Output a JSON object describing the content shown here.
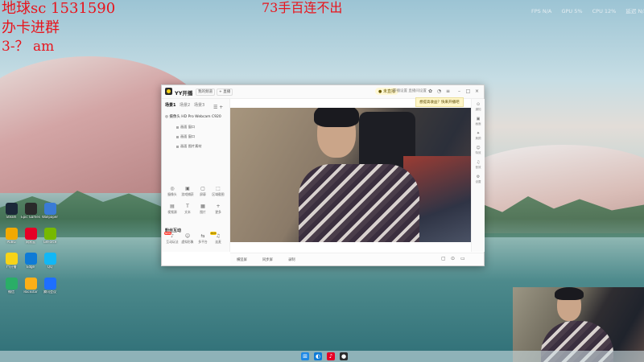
{
  "overlay": {
    "line1": "地球sc  1531590",
    "line2": "办卡进群",
    "line3": "3-？ am",
    "banner": "73手百连不出"
  },
  "perf": {
    "fps": "FPS  N/A",
    "gpu": "GPU  5%",
    "cpu": "CPU  12%",
    "latency": "延迟  N/A"
  },
  "desktop_icons": [
    {
      "label": "Steam",
      "color": "#1b2838"
    },
    {
      "label": "Epic Games",
      "color": "#2a2a2a"
    },
    {
      "label": "Wallpaper",
      "color": "#3a7bd5"
    },
    {
      "label": "PUBG",
      "color": "#f2a900"
    },
    {
      "label": "网易云",
      "color": "#e60026"
    },
    {
      "label": "GeForce",
      "color": "#76b900"
    },
    {
      "label": "YY开播",
      "color": "#f7d318"
    },
    {
      "label": "Edge",
      "color": "#0f7bd6"
    },
    {
      "label": "QQ",
      "color": "#12b7f5"
    },
    {
      "label": "微信",
      "color": "#2aae67"
    },
    {
      "label": "Rockstar",
      "color": "#fcaf17"
    },
    {
      "label": "腾讯会议",
      "color": "#1e6fff"
    }
  ],
  "window": {
    "app_name": "YY开播",
    "btn_a": "我的频道",
    "btn_b": "+ 直播",
    "live_label": "● 未直播",
    "live_note": "开播设置  直播间设置",
    "tooltip": "想提高收益？快来开播吧",
    "tabs": [
      "场景1",
      "场景2",
      "场景3"
    ],
    "scene_head": "摄像头 HD Pro Webcam C920",
    "scene_items": [
      "画面 窗口",
      "画面 窗口",
      "画面 图片素材"
    ],
    "tools": [
      {
        "label": "摄像头",
        "icon": "◎"
      },
      {
        "label": "游戏捕获",
        "icon": "▣"
      },
      {
        "label": "屏幕",
        "icon": "▢"
      },
      {
        "label": "区域截图",
        "icon": "⬚"
      },
      {
        "label": "视频源",
        "icon": "▤"
      },
      {
        "label": "文本",
        "icon": "T"
      },
      {
        "label": "图片",
        "icon": "▦"
      },
      {
        "label": "更多",
        "icon": "+"
      }
    ],
    "section_title": "粉丝互动",
    "interact_tools": [
      {
        "label": "互动玩法",
        "icon": "♪",
        "badge": "NEW"
      },
      {
        "label": "虚拟形象",
        "icon": "☺",
        "badge": ""
      },
      {
        "label": "多平台",
        "icon": "⇆",
        "badge": ""
      },
      {
        "label": "连麦",
        "icon": "♫",
        "badge": "HOT"
      }
    ],
    "right_tools": [
      {
        "label": "通知",
        "icon": "⊙"
      },
      {
        "label": "画面",
        "icon": "▣"
      },
      {
        "label": "美颜",
        "icon": "✦"
      },
      {
        "label": "特效",
        "icon": "☺"
      },
      {
        "label": "音效",
        "icon": "♫"
      },
      {
        "label": "设置",
        "icon": "⚙"
      }
    ],
    "bottom": {
      "left1": "横竖屏",
      "left2": "同步屏",
      "left3": "录制",
      "icons": [
        "▢",
        "⊙",
        "▭"
      ]
    }
  },
  "taskbar_icons": [
    {
      "name": "windows",
      "color": "#1e88e5",
      "glyph": "⊞"
    },
    {
      "name": "edge",
      "color": "#0f7bd6",
      "glyph": "◐"
    },
    {
      "name": "netease",
      "color": "#e60026",
      "glyph": "♪"
    },
    {
      "name": "yy",
      "color": "#2b2b2b",
      "glyph": "●"
    }
  ]
}
